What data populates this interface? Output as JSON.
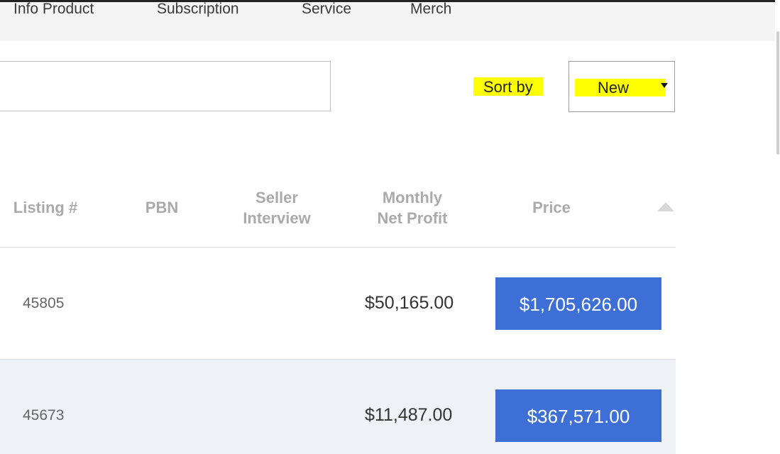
{
  "nav": {
    "items": [
      "Info Product",
      "Subscription",
      "Service",
      "Merch"
    ]
  },
  "search": {
    "value": "",
    "placeholder": ""
  },
  "sort": {
    "label": "Sort by",
    "selected": "New"
  },
  "table": {
    "headers": {
      "listing": "Listing #",
      "pbn": "PBN",
      "seller_line1": "Seller",
      "seller_line2": "Interview",
      "profit_line1": "Monthly",
      "profit_line2": "Net Profit",
      "price": "Price"
    },
    "rows": [
      {
        "listing": "45805",
        "pbn": "",
        "seller_interview": "",
        "monthly_net_profit": "$50,165.00",
        "price": "$1,705,626.00"
      },
      {
        "listing": "45673",
        "pbn": "",
        "seller_interview": "",
        "monthly_net_profit": "$11,487.00",
        "price": "$367,571.00"
      }
    ]
  },
  "colors": {
    "highlight": "#ffff00",
    "price_button": "#3d6fd6",
    "alt_row": "#eef2f7",
    "header_text": "#aaaaaa"
  }
}
